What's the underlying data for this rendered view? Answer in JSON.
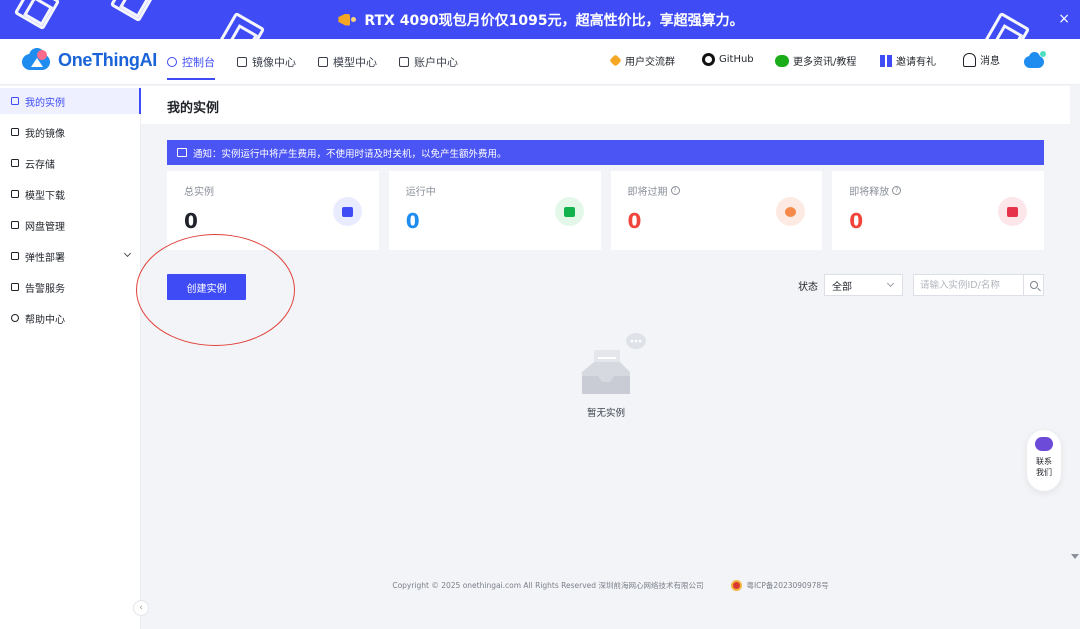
{
  "banner": {
    "text": "RTX 4090现包月价仅1095元，超高性价比，享超强算力。",
    "close": "×"
  },
  "header": {
    "logo": "OneThingAI",
    "nav": [
      {
        "label": "控制台",
        "icon": "dashboard-icon",
        "active": true
      },
      {
        "label": "镜像中心",
        "icon": "image-icon"
      },
      {
        "label": "模型中心",
        "icon": "model-icon"
      },
      {
        "label": "账户中心",
        "icon": "account-icon"
      }
    ],
    "right": {
      "users": "用户交流群",
      "github": "GitHub",
      "news": "更多资讯/教程",
      "invite": "邀请有礼",
      "messages": "消息"
    }
  },
  "sidebar": {
    "items": [
      {
        "label": "我的实例",
        "icon": "instance-icon"
      },
      {
        "label": "我的镜像",
        "icon": "mirror-icon"
      },
      {
        "label": "云存储",
        "icon": "folder-icon"
      },
      {
        "label": "模型下载",
        "icon": "download-icon"
      },
      {
        "label": "网盘管理",
        "icon": "disk-icon"
      },
      {
        "label": "弹性部署",
        "icon": "deploy-icon"
      },
      {
        "label": "告警服务",
        "icon": "alarm-icon"
      },
      {
        "label": "帮助中心",
        "icon": "help-icon"
      }
    ],
    "collapse": "‹"
  },
  "main": {
    "title": "我的实例",
    "notice": "通知：实例运行中将产生费用，不使用时请及时关机，以免产生额外费用。",
    "stats": [
      {
        "label": "总实例",
        "value": "0",
        "color": "#1f2329",
        "icon_bg": "#e9ecff",
        "icon_fg": "#3f4cf5",
        "help": false
      },
      {
        "label": "运行中",
        "value": "0",
        "color": "#1f8cf0",
        "icon_bg": "#e4f8ea",
        "icon_fg": "#12b34d",
        "help": false
      },
      {
        "label": "即将过期",
        "value": "0",
        "color": "#f0453a",
        "icon_bg": "#fdebe3",
        "icon_fg": "#f58a4b",
        "help": true
      },
      {
        "label": "即将释放",
        "value": "0",
        "color": "#f0453a",
        "icon_bg": "#fde6ea",
        "icon_fg": "#e6334b",
        "help": true
      }
    ],
    "create_button": "创建实例",
    "filter": {
      "label": "状态",
      "value": "全部"
    },
    "search": {
      "placeholder": "请输入实例ID/名称"
    },
    "empty": "暂无实例",
    "contact": [
      "联系",
      "我们"
    ]
  },
  "footer": {
    "copyright": "Copyright © 2025 onethingai.com All Rights Reserved 深圳前海网心网络技术有限公司",
    "icp": "粤ICP备2023090978号"
  }
}
